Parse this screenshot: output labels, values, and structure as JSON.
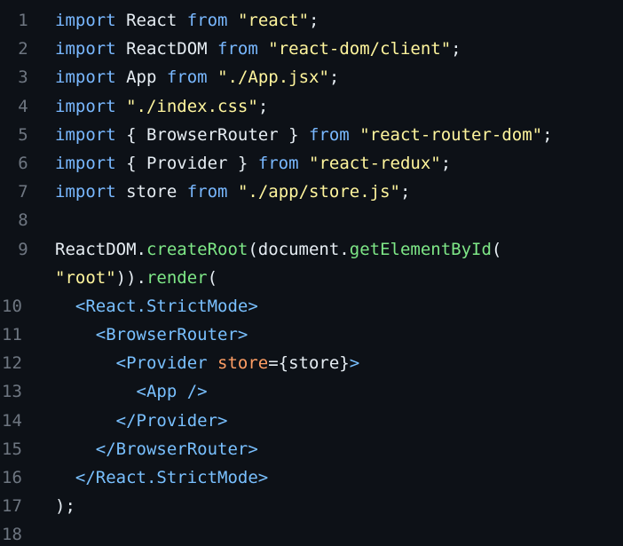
{
  "editor": {
    "lines": [
      {
        "num": "1",
        "tokens": [
          [
            "kw",
            "import"
          ],
          [
            "id",
            " React "
          ],
          [
            "kw",
            "from"
          ],
          [
            "id",
            " "
          ],
          [
            "str",
            "\"react\""
          ],
          [
            "punc",
            ";"
          ]
        ]
      },
      {
        "num": "2",
        "tokens": [
          [
            "kw",
            "import"
          ],
          [
            "id",
            " ReactDOM "
          ],
          [
            "kw",
            "from"
          ],
          [
            "id",
            " "
          ],
          [
            "str",
            "\"react-dom/client\""
          ],
          [
            "punc",
            ";"
          ]
        ]
      },
      {
        "num": "3",
        "tokens": [
          [
            "kw",
            "import"
          ],
          [
            "id",
            " App "
          ],
          [
            "kw",
            "from"
          ],
          [
            "id",
            " "
          ],
          [
            "str",
            "\"./App.jsx\""
          ],
          [
            "punc",
            ";"
          ]
        ]
      },
      {
        "num": "4",
        "tokens": [
          [
            "kw",
            "import"
          ],
          [
            "id",
            " "
          ],
          [
            "str",
            "\"./index.css\""
          ],
          [
            "punc",
            ";"
          ]
        ]
      },
      {
        "num": "5",
        "tokens": [
          [
            "kw",
            "import"
          ],
          [
            "id",
            " { BrowserRouter } "
          ],
          [
            "kw",
            "from"
          ],
          [
            "id",
            " "
          ],
          [
            "str",
            "\"react-router-dom\""
          ],
          [
            "punc",
            ";"
          ]
        ]
      },
      {
        "num": "6",
        "tokens": [
          [
            "kw",
            "import"
          ],
          [
            "id",
            " { Provider } "
          ],
          [
            "kw",
            "from"
          ],
          [
            "id",
            " "
          ],
          [
            "str",
            "\"react-redux\""
          ],
          [
            "punc",
            ";"
          ]
        ]
      },
      {
        "num": "7",
        "tokens": [
          [
            "kw",
            "import"
          ],
          [
            "id",
            " store "
          ],
          [
            "kw",
            "from"
          ],
          [
            "id",
            " "
          ],
          [
            "str",
            "\"./app/store.js\""
          ],
          [
            "punc",
            ";"
          ]
        ]
      },
      {
        "num": "8",
        "tokens": []
      },
      {
        "num": "9",
        "tokens": [
          [
            "id",
            "ReactDOM"
          ],
          [
            "dot",
            "."
          ],
          [
            "fn",
            "createRoot"
          ],
          [
            "punc",
            "(document."
          ],
          [
            "fn",
            "getElementById"
          ],
          [
            "punc",
            "("
          ]
        ]
      },
      {
        "num": "",
        "tokens": [
          [
            "str",
            "\"root\""
          ],
          [
            "punc",
            "))."
          ],
          [
            "fn",
            "render"
          ],
          [
            "punc",
            "("
          ]
        ]
      },
      {
        "num": "10",
        "tokens": [
          [
            "id",
            "  "
          ],
          [
            "tag",
            "<React.StrictMode>"
          ]
        ]
      },
      {
        "num": "11",
        "tokens": [
          [
            "id",
            "    "
          ],
          [
            "tag",
            "<BrowserRouter>"
          ]
        ]
      },
      {
        "num": "12",
        "tokens": [
          [
            "id",
            "      "
          ],
          [
            "tag",
            "<Provider "
          ],
          [
            "attr",
            "store"
          ],
          [
            "punc",
            "={store}"
          ],
          [
            "tag",
            ">"
          ]
        ]
      },
      {
        "num": "13",
        "tokens": [
          [
            "id",
            "        "
          ],
          [
            "tag",
            "<App />"
          ]
        ]
      },
      {
        "num": "14",
        "tokens": [
          [
            "id",
            "      "
          ],
          [
            "tag",
            "</Provider>"
          ]
        ]
      },
      {
        "num": "15",
        "tokens": [
          [
            "id",
            "    "
          ],
          [
            "tag",
            "</BrowserRouter>"
          ]
        ]
      },
      {
        "num": "16",
        "tokens": [
          [
            "id",
            "  "
          ],
          [
            "tag",
            "</React.StrictMode>"
          ]
        ]
      },
      {
        "num": "17",
        "tokens": [
          [
            "punc",
            ");"
          ]
        ]
      },
      {
        "num": "18",
        "tokens": []
      }
    ]
  },
  "colors": {
    "background": "#0d1117",
    "line_number": "#6e7681",
    "keyword": "#79b8ff",
    "string": "#fff59d",
    "function": "#7ee787",
    "jsx_tag": "#79c0ff",
    "jsx_attribute": "#ff9e64",
    "text": "#e6edf3"
  }
}
